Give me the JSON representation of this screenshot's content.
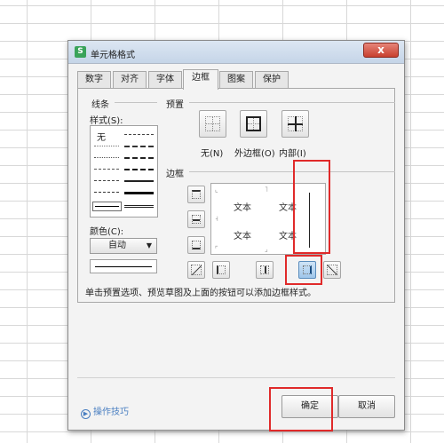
{
  "dialog": {
    "title": "单元格格式",
    "app_icon": "S",
    "close_glyph": "x"
  },
  "tabs": [
    "数字",
    "对齐",
    "字体",
    "边框",
    "图案",
    "保护"
  ],
  "active_tab": "边框",
  "line_section": {
    "group_label": "线条",
    "style_label": "样式(S):",
    "none_label": "无",
    "color_label": "颜色(C):",
    "color_value": "自动"
  },
  "preset_section": {
    "group_label": "预置",
    "none_label": "无(N)",
    "outline_label": "外边框(O)",
    "inside_label": "内部(I)"
  },
  "border_section": {
    "group_label": "边框",
    "preview_texts": [
      "文本",
      "文本",
      "文本",
      "文本"
    ]
  },
  "hint_text": "单击预置选项、预览草图及上面的按钮可以添加边框样式。",
  "footer": {
    "tips_label": "操作技巧",
    "ok_label": "确定",
    "cancel_label": "取消"
  },
  "colors": {
    "highlight_red": "#e02a2a",
    "selected_button": "#9fc6ea",
    "link_blue": "#4a7fc1"
  }
}
